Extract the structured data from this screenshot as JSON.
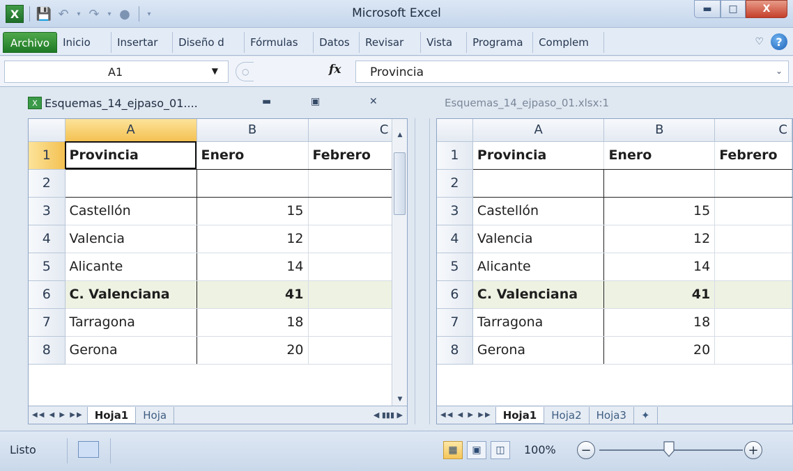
{
  "window": {
    "title": "Microsoft Excel",
    "app_icon": "excel-icon"
  },
  "ribbon": {
    "tabs": [
      {
        "label": "Archivo"
      },
      {
        "label": "Inicio"
      },
      {
        "label": "Insertar"
      },
      {
        "label": "Diseño d"
      },
      {
        "label": "Fórmulas"
      },
      {
        "label": "Datos"
      },
      {
        "label": "Revisar"
      },
      {
        "label": "Vista"
      },
      {
        "label": "Programa"
      },
      {
        "label": "Complem"
      }
    ]
  },
  "formula_bar": {
    "name_box": "A1",
    "fx": "fx",
    "content": "Provincia"
  },
  "left_window": {
    "title": "Esquemas_14_ejpaso_01....",
    "columns": [
      "A",
      "B",
      "C"
    ],
    "rows": [
      {
        "n": "1",
        "a": "Provincia",
        "b": "Enero",
        "c": "Febrero"
      },
      {
        "n": "2",
        "a": "",
        "b": "",
        "c": ""
      },
      {
        "n": "3",
        "a": "Castellón",
        "b": "15",
        "c": ""
      },
      {
        "n": "4",
        "a": "Valencia",
        "b": "12",
        "c": ""
      },
      {
        "n": "5",
        "a": "Alicante",
        "b": "14",
        "c": ""
      },
      {
        "n": "6",
        "a": "C. Valenciana",
        "b": "41",
        "c": ""
      },
      {
        "n": "7",
        "a": "Tarragona",
        "b": "18",
        "c": ""
      },
      {
        "n": "8",
        "a": "Gerona",
        "b": "20",
        "c": ""
      }
    ],
    "sheets": [
      "Hoja1",
      "Hoja"
    ]
  },
  "right_window": {
    "title": "Esquemas_14_ejpaso_01.xlsx:1",
    "columns": [
      "A",
      "B",
      "C"
    ],
    "rows": [
      {
        "n": "1",
        "a": "Provincia",
        "b": "Enero",
        "c": "Febrero"
      },
      {
        "n": "2",
        "a": "",
        "b": "",
        "c": ""
      },
      {
        "n": "3",
        "a": "Castellón",
        "b": "15",
        "c": ""
      },
      {
        "n": "4",
        "a": "Valencia",
        "b": "12",
        "c": ""
      },
      {
        "n": "5",
        "a": "Alicante",
        "b": "14",
        "c": ""
      },
      {
        "n": "6",
        "a": "C. Valenciana",
        "b": "41",
        "c": ""
      },
      {
        "n": "7",
        "a": "Tarragona",
        "b": "18",
        "c": ""
      },
      {
        "n": "8",
        "a": "Gerona",
        "b": "20",
        "c": ""
      }
    ],
    "sheets": [
      "Hoja1",
      "Hoja2",
      "Hoja3"
    ]
  },
  "status_bar": {
    "status": "Listo",
    "zoom": "100%",
    "zoom_level": 1.0
  },
  "colors": {
    "accent_green": "#1f7a26",
    "selection": "#f4c152",
    "total_row": "#eef2e3"
  }
}
